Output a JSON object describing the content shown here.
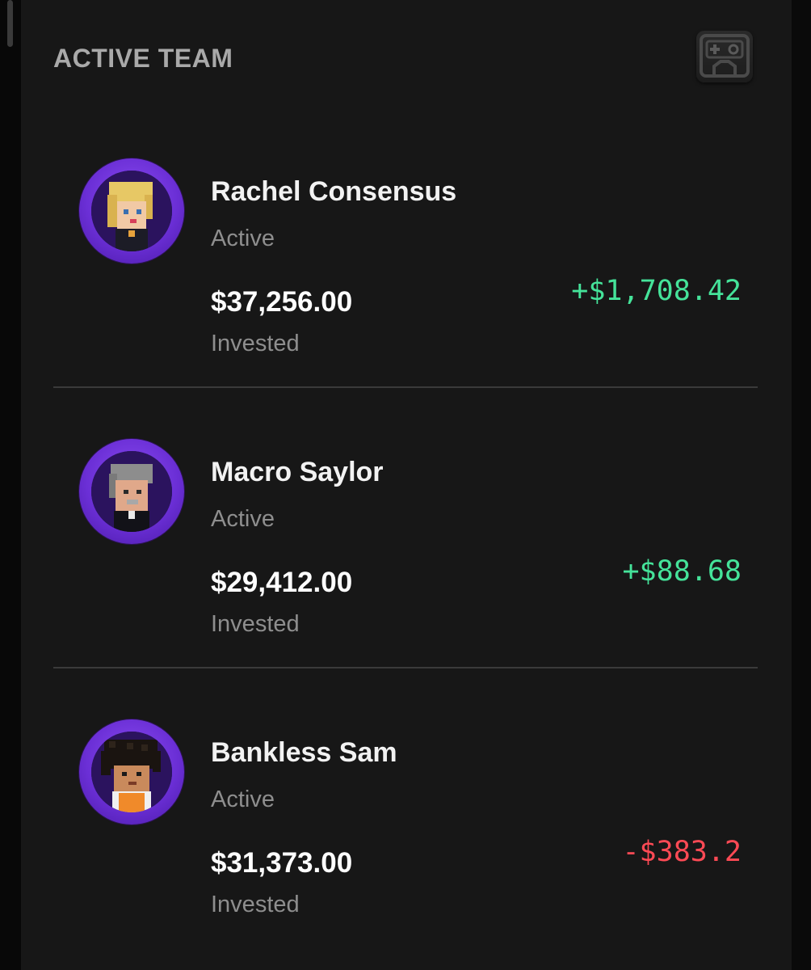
{
  "header": {
    "title": "ACTIVE TEAM",
    "action_icon": "game-controller-icon"
  },
  "colors": {
    "positive": "#45e39a",
    "negative": "#ff4a55",
    "avatar_ring": "#6b2fd6"
  },
  "members": [
    {
      "name": "Rachel Consensus",
      "status": "Active",
      "invested": "$37,256.00",
      "invested_label": "Invested",
      "pnl": "+$1,708.42",
      "pnl_sign": "positive",
      "avatar_icon": "blonde-voxel-avatar-icon"
    },
    {
      "name": "Macro Saylor",
      "status": "Active",
      "invested": "$29,412.00",
      "invested_label": "Invested",
      "pnl": "+$88.68",
      "pnl_sign": "positive",
      "avatar_icon": "gray-hair-voxel-avatar-icon"
    },
    {
      "name": "Bankless Sam",
      "status": "Active",
      "invested": "$31,373.00",
      "invested_label": "Invested",
      "pnl": "-$383.2",
      "pnl_sign": "negative",
      "avatar_icon": "curly-hair-voxel-avatar-icon"
    }
  ]
}
